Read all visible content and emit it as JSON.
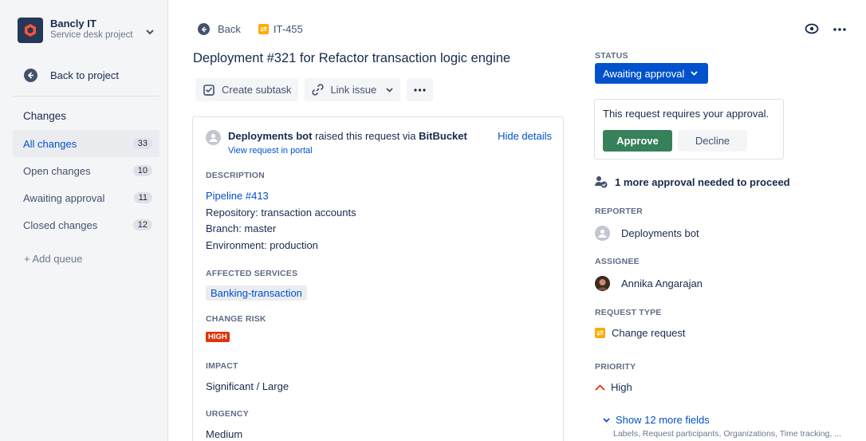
{
  "sidebar": {
    "project_name": "Bancly IT",
    "project_sub": "Service desk project",
    "back_label": "Back to project",
    "heading": "Changes",
    "items": [
      {
        "label": "All changes",
        "count": "33"
      },
      {
        "label": "Open changes",
        "count": "10"
      },
      {
        "label": "Awaiting approval",
        "count": "11"
      },
      {
        "label": "Closed changes",
        "count": "12"
      }
    ],
    "add_queue": "+ Add queue"
  },
  "nav": {
    "back": "Back",
    "issue_key": "IT-455"
  },
  "issue": {
    "title": "Deployment #321 for Refactor transaction logic engine",
    "toolbar": {
      "create_subtask": "Create subtask",
      "link_issue": "Link issue"
    },
    "raised_by": "Deployments bot",
    "raised_mid": " raised this request via ",
    "raised_via": "BitBucket",
    "portal_link": "View request in portal",
    "hide_details": "Hide details",
    "description_label": "DESCRIPTION",
    "pipeline": "Pipeline #413",
    "repository": "Repository: transaction accounts",
    "branch": "Branch: master",
    "environment": "Environment: production",
    "affected_label": "AFFECTED SERVICES",
    "affected_service": "Banking-transaction",
    "risk_label": "CHANGE RISK",
    "risk_value": "HIGH",
    "impact_label": "IMPACT",
    "impact_value": "Significant / Large",
    "urgency_label": "URGENCY",
    "urgency_value": "Medium"
  },
  "details": {
    "status_label": "STATUS",
    "status_value": "Awaiting approval",
    "approval_text": "This request requires your approval.",
    "approve": "Approve",
    "decline": "Decline",
    "more_approval": "1 more approval needed to proceed",
    "reporter_label": "REPORTER",
    "reporter": "Deployments bot",
    "assignee_label": "ASSIGNEE",
    "assignee": "Annika Angarajan",
    "request_type_label": "REQUEST TYPE",
    "request_type": "Change request",
    "priority_label": "PRIORITY",
    "priority": "High",
    "show_more": "Show 12 more fields",
    "show_more_sub": "Labels, Request participants, Organizations, Time tracking, ..."
  },
  "colors": {
    "brand_blue": "#0052CC",
    "approve_green": "#36805A",
    "risk_red": "#DE350B",
    "change_orange": "#FFAB00"
  }
}
